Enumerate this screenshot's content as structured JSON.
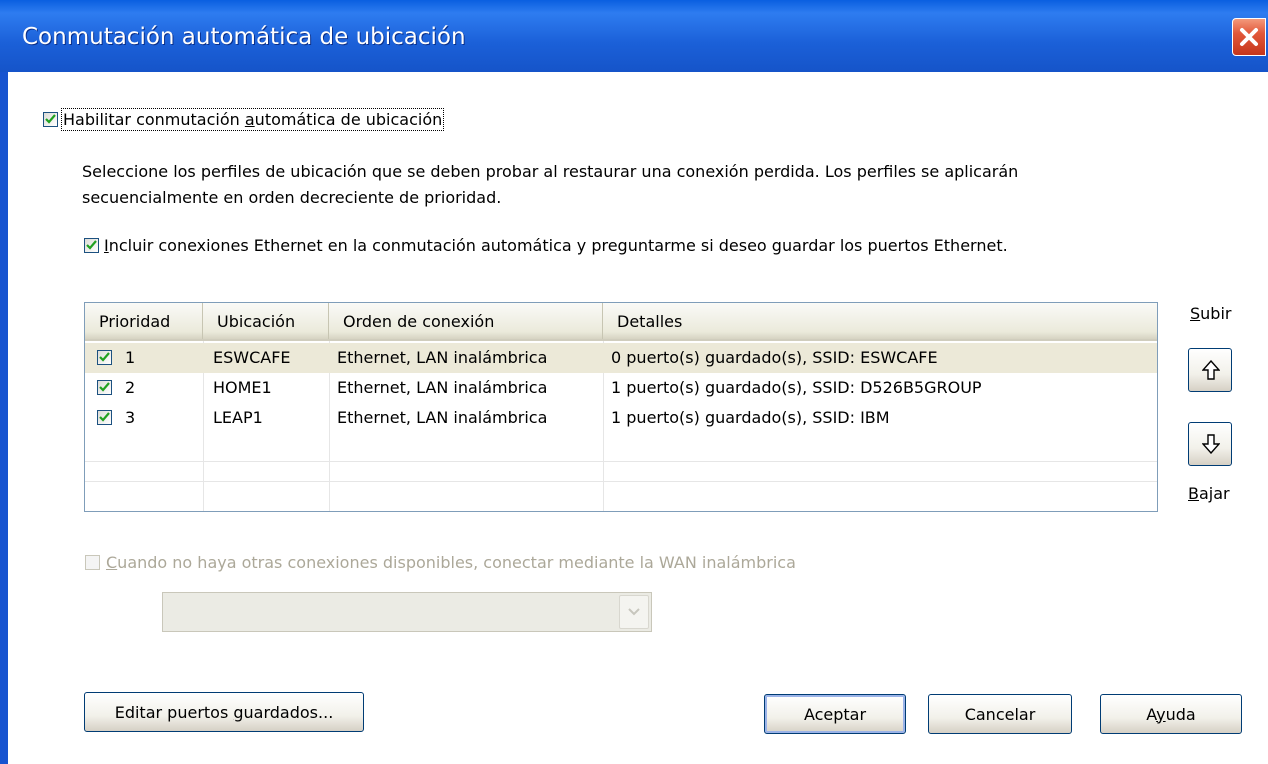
{
  "window": {
    "title": "Conmutación automática de ubicación"
  },
  "enable_switching": {
    "checked": true,
    "pre": "Habilitar conmutación ",
    "mnemonic": "a",
    "post": "utomática de ubicación"
  },
  "description": {
    "line1": "Seleccione los perfiles de ubicación que se deben probar al restaurar una conexión perdida. Los perfiles se aplicarán",
    "line2": "secuencialmente en orden decreciente de prioridad."
  },
  "include_ethernet": {
    "checked": true,
    "mnemonic": "I",
    "post": "ncluir conexiones Ethernet en la conmutación automática y preguntarme si deseo guardar los puertos Ethernet."
  },
  "table": {
    "columns": [
      "Prioridad",
      "Ubicación",
      "Orden de conexión",
      "Detalles"
    ],
    "rows": [
      {
        "checked": true,
        "priority": "1",
        "location": "ESWCAFE",
        "order": "Ethernet, LAN inalámbrica",
        "details": "0 puerto(s) guardado(s),  SSID: ESWCAFE",
        "selected": true
      },
      {
        "checked": true,
        "priority": "2",
        "location": "HOME1",
        "order": "Ethernet, LAN inalámbrica",
        "details": "1 puerto(s) guardado(s),  SSID: D526B5GROUP",
        "selected": false
      },
      {
        "checked": true,
        "priority": "3",
        "location": "LEAP1",
        "order": "Ethernet, LAN inalámbrica",
        "details": "1 puerto(s) guardado(s),  SSID: IBM",
        "selected": false
      }
    ]
  },
  "move": {
    "up_mnemonic": "S",
    "up_rest": "ubir",
    "down_mnemonic": "B",
    "down_rest": "ajar",
    "up_icon": "arrow-up-icon",
    "down_icon": "arrow-down-icon"
  },
  "wan": {
    "checked": false,
    "enabled": false,
    "mnemonic": "C",
    "post": "uando no haya otras conexiones disponibles, conectar mediante la WAN inalámbrica",
    "combo_value": ""
  },
  "buttons": {
    "edit_pre": "Editar puertos ",
    "edit_mnemonic": "g",
    "edit_post": "uardados...",
    "accept": "Aceptar",
    "cancel": "Cancelar",
    "help_pre": "A",
    "help_mnemonic": "y",
    "help_post": "uda"
  },
  "colors": {
    "titlebar": "#1554c9",
    "close": "#e2583a",
    "selected_row": "#ece9d8",
    "disabled_text": "#aca899"
  }
}
